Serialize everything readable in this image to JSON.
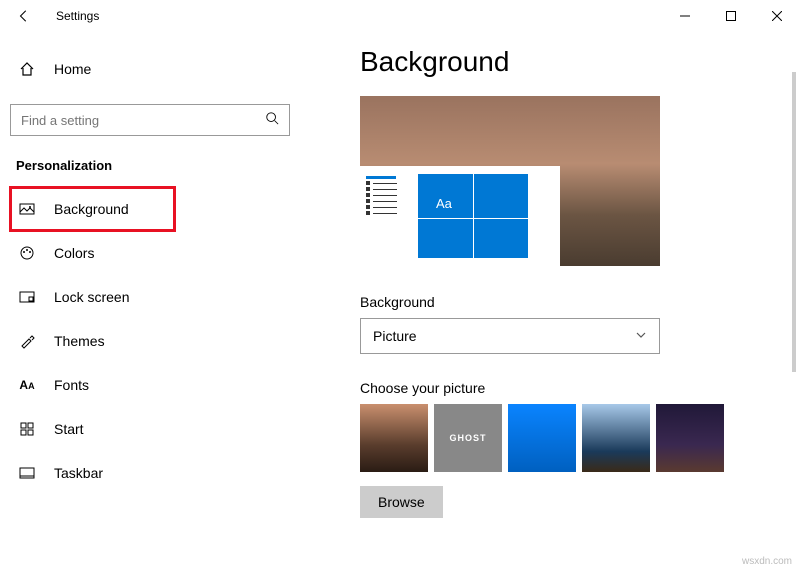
{
  "window": {
    "title": "Settings"
  },
  "sidebar": {
    "home_label": "Home",
    "search_placeholder": "Find a setting",
    "category": "Personalization",
    "items": [
      {
        "label": "Background"
      },
      {
        "label": "Colors"
      },
      {
        "label": "Lock screen"
      },
      {
        "label": "Themes"
      },
      {
        "label": "Fonts"
      },
      {
        "label": "Start"
      },
      {
        "label": "Taskbar"
      }
    ]
  },
  "main": {
    "title": "Background",
    "preview_sample_text": "Aa",
    "background_label": "Background",
    "background_value": "Picture",
    "choose_picture_label": "Choose your picture",
    "thumb2_text": "GHOST",
    "browse_label": "Browse"
  },
  "watermark": "wsxdn.com"
}
